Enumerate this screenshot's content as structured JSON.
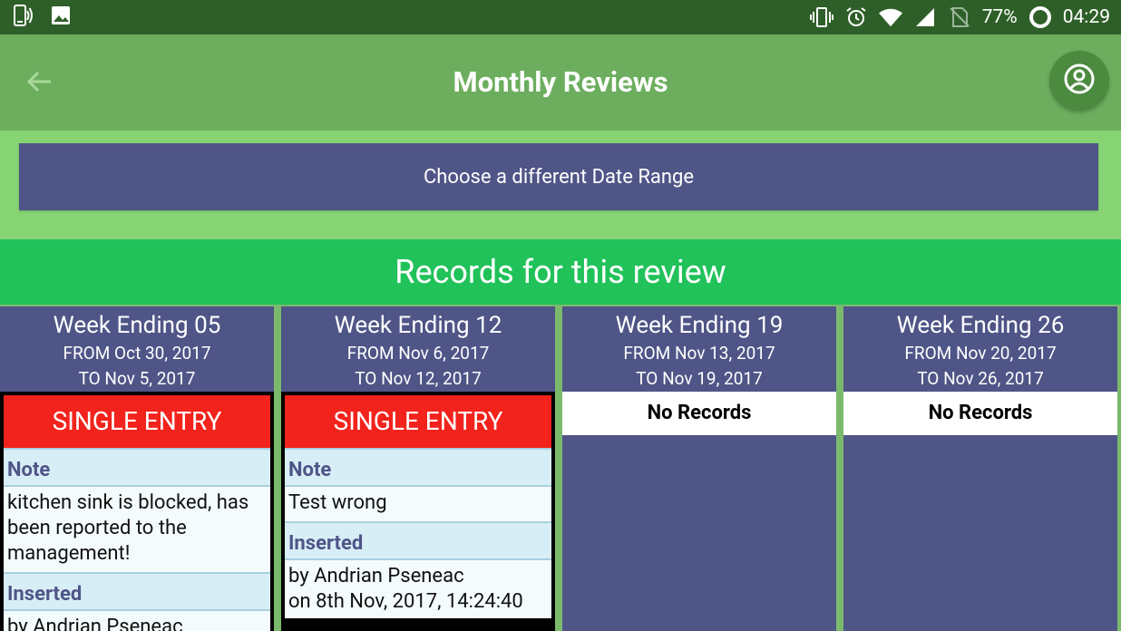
{
  "status_bar": {
    "battery": "77%",
    "time": "04:29",
    "left_icons": [
      "phone-signal-icon",
      "image-icon"
    ],
    "right_icons": [
      "vibrate-icon",
      "alarm-icon",
      "wifi-icon",
      "cell-signal-icon",
      "no-sim-icon",
      "battery-ring-icon"
    ]
  },
  "app_bar": {
    "title": "Monthly Reviews",
    "back_icon": "arrow-left-icon",
    "profile_icon": "account-circle-icon"
  },
  "date_range_button": "Choose a different Date Range",
  "records_header": "Records for this review",
  "colors": {
    "status_bar": "#2f5f28",
    "app_bar": "#6cae5e",
    "band": "#87d475",
    "records_header": "#21c25a",
    "column": "#4f5587",
    "entry_title": "#f2231c"
  },
  "weeks": [
    {
      "title": "Week Ending 05",
      "from": "FROM Oct 30, 2017",
      "to": "TO Nov 5, 2017",
      "entry": {
        "type": "SINGLE ENTRY",
        "note_label": "Note",
        "note": "kitchen sink is blocked, has been reported to the management!",
        "inserted_label": "Inserted",
        "inserted_by": "by Andrian Pseneac"
      }
    },
    {
      "title": "Week Ending 12",
      "from": "FROM Nov 6, 2017",
      "to": "TO Nov 12, 2017",
      "entry": {
        "type": "SINGLE ENTRY",
        "note_label": "Note",
        "note": "Test wrong",
        "inserted_label": "Inserted",
        "inserted_by": "by Andrian Pseneac",
        "inserted_on": "on 8th Nov, 2017, 14:24:40"
      }
    },
    {
      "title": "Week Ending 19",
      "from": "FROM Nov 13, 2017",
      "to": "TO Nov 19, 2017",
      "no_records": "No Records"
    },
    {
      "title": "Week Ending 26",
      "from": "FROM Nov 20, 2017",
      "to": "TO Nov 26, 2017",
      "no_records": "No Records"
    }
  ]
}
